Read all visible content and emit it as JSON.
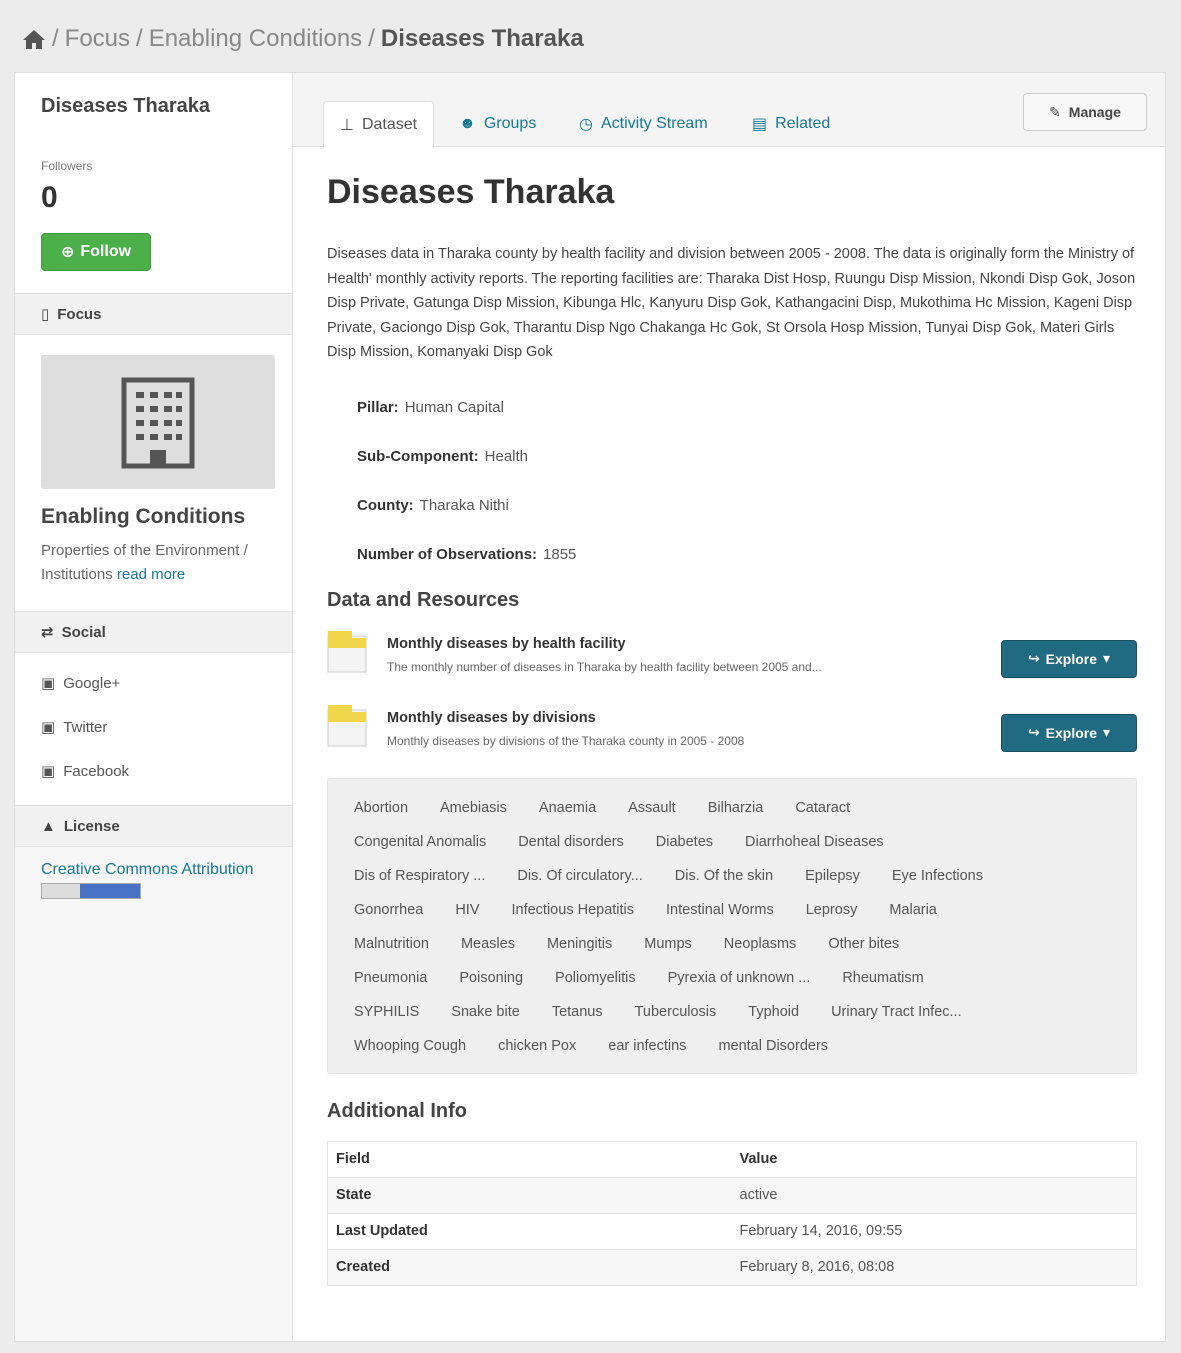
{
  "breadcrumb": {
    "home_icon": "home-icon",
    "items": [
      "Focus",
      "Enabling Conditions"
    ],
    "current": "Diseases Tharaka",
    "separator": "/"
  },
  "sidebar": {
    "title": "Diseases Tharaka",
    "followers_label": "Followers",
    "followers_count": "0",
    "follow_label": "Follow",
    "focus_heading": "Focus",
    "focus_name": "Enabling Conditions",
    "focus_desc": "Properties of the Environment / Institutions",
    "read_more": "read more",
    "social_heading": "Social",
    "social_items": [
      "Google+",
      "Twitter",
      "Facebook"
    ],
    "license_heading": "License",
    "license_link": "Creative Commons Attribution"
  },
  "tabs": [
    {
      "label": "Dataset",
      "icon": "sitemap-icon"
    },
    {
      "label": "Groups",
      "icon": "users-icon"
    },
    {
      "label": "Activity Stream",
      "icon": "clock-icon"
    },
    {
      "label": "Related",
      "icon": "picture-icon"
    }
  ],
  "manage_label": "Manage",
  "dataset": {
    "title": "Diseases Tharaka",
    "notes": "Diseases data in Tharaka county by health facility and division between 2005 - 2008. The data is originally form the Ministry of Health' monthly activity reports. The reporting facilities are: Tharaka Dist Hosp, Ruungu Disp Mission, Nkondi Disp Gok, Joson Disp Private, Gatunga Disp Mission, Kibunga Hlc, Kanyuru Disp Gok, Kathangacini Disp, Mukothima Hc Mission, Kageni Disp Private, Gaciongo Disp Gok, Tharantu Disp Ngo Chakanga Hc Gok, St Orsola Hosp Mission, Tunyai Disp Gok, Materi Girls Disp Mission, Komanyaki Disp Gok",
    "extras": [
      {
        "key": "Pillar:",
        "value": "Human Capital"
      },
      {
        "key": "Sub-Component:",
        "value": "Health"
      },
      {
        "key": "County:",
        "value": "Tharaka Nithi"
      },
      {
        "key": "Number of Observations:",
        "value": "1855"
      }
    ]
  },
  "resources_heading": "Data and Resources",
  "resources": [
    {
      "name": "Monthly diseases by health facility",
      "desc": "The monthly number of diseases in Tharaka by health facility between 2005 and...",
      "button": "Explore"
    },
    {
      "name": "Monthly diseases by divisions",
      "desc": "Monthly diseases by divisions of the Tharaka county in 2005 - 2008",
      "button": "Explore"
    }
  ],
  "tags": [
    [
      "Abortion",
      "Amebiasis",
      "Anaemia",
      "Assault",
      "Bilharzia",
      "Cataract"
    ],
    [
      "Congenital Anomalis",
      "Dental disorders",
      "Diabetes",
      "Diarrhoheal Diseases"
    ],
    [
      "Dis of Respiratory ...",
      "Dis. Of circulatory...",
      "Dis. Of the skin",
      "Epilepsy",
      "Eye Infections"
    ],
    [
      "Gonorrhea",
      "HIV",
      "Infectious Hepatitis",
      "Intestinal Worms",
      "Leprosy",
      "Malaria"
    ],
    [
      "Malnutrition",
      "Measles",
      "Meningitis",
      "Mumps",
      "Neoplasms",
      "Other bites"
    ],
    [
      "Pneumonia",
      "Poisoning",
      "Poliomyelitis",
      "Pyrexia of unknown ...",
      "Rheumatism"
    ],
    [
      "SYPHILIS",
      "Snake bite",
      "Tetanus",
      "Tuberculosis",
      "Typhoid",
      "Urinary Tract Infec..."
    ],
    [
      "Whooping Cough",
      "chicken Pox",
      "ear infectins",
      "mental Disorders"
    ]
  ],
  "additional_heading": "Additional Info",
  "additional": {
    "headers": [
      "Field",
      "Value"
    ],
    "rows": [
      [
        "State",
        "active"
      ],
      [
        "Last Updated",
        "February 14, 2016, 09:55"
      ],
      [
        "Created",
        "February 8, 2016, 08:08"
      ]
    ]
  },
  "colors": {
    "link": "#187794",
    "follow": "#4cb04a",
    "explore": "#206b82"
  }
}
